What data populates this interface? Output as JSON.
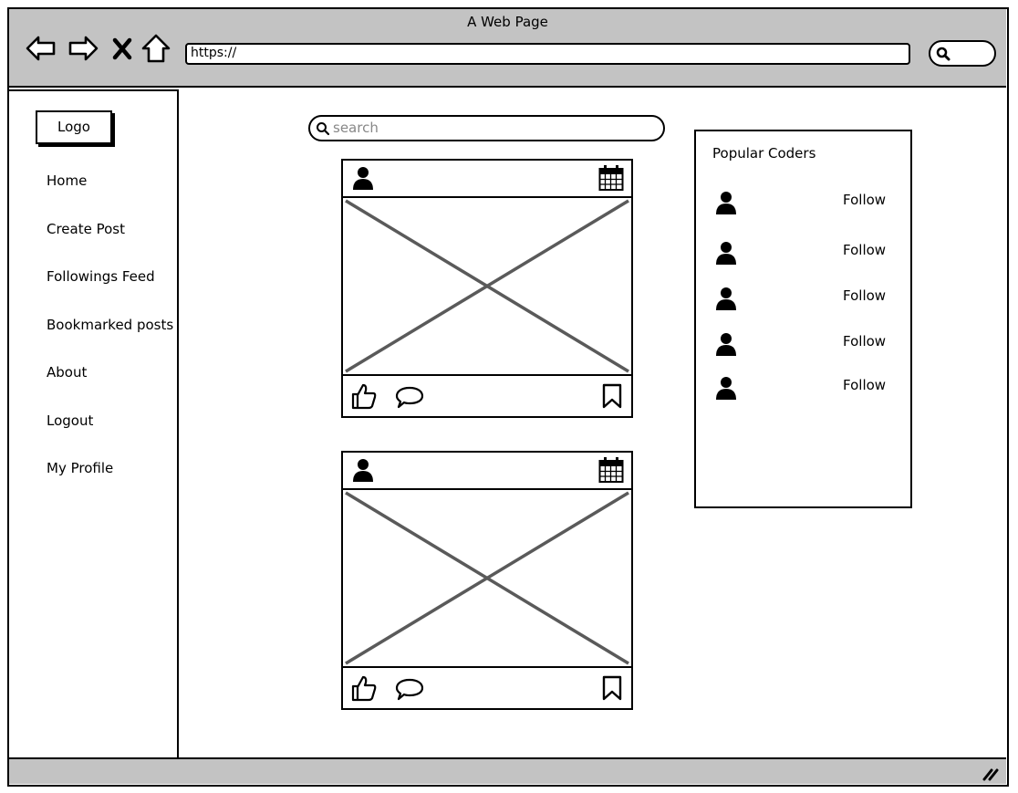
{
  "window": {
    "title": "A Web Page"
  },
  "browser": {
    "url": "https://",
    "nav": [
      "back-arrow-icon",
      "forward-arrow-icon",
      "stop-x-icon",
      "home-icon"
    ]
  },
  "sidebar": {
    "logo": "Logo",
    "items": [
      {
        "label": "Home"
      },
      {
        "label": "Create Post"
      },
      {
        "label": "Followings Feed"
      },
      {
        "label": "Bookmarked posts"
      },
      {
        "label": "About"
      },
      {
        "label": "Logout"
      },
      {
        "label": "My Profile"
      }
    ]
  },
  "search": {
    "placeholder": "search"
  },
  "posts": [
    {
      "icons": [
        "user-icon",
        "calendar-icon",
        "image-placeholder",
        "like-thumb-icon",
        "comment-bubble-icon",
        "bookmark-icon"
      ]
    },
    {
      "icons": [
        "user-icon",
        "calendar-icon",
        "image-placeholder",
        "like-thumb-icon",
        "comment-bubble-icon",
        "bookmark-icon"
      ]
    }
  ],
  "popular": {
    "title": "Popular Coders",
    "coders": [
      {
        "action": "Follow"
      },
      {
        "action": "Follow"
      },
      {
        "action": "Follow"
      },
      {
        "action": "Follow"
      },
      {
        "action": "Follow"
      }
    ]
  },
  "colors": {
    "chrome": "#c3c3c3",
    "stroke": "#000000",
    "placeholder_x": "#5a5a5a"
  }
}
